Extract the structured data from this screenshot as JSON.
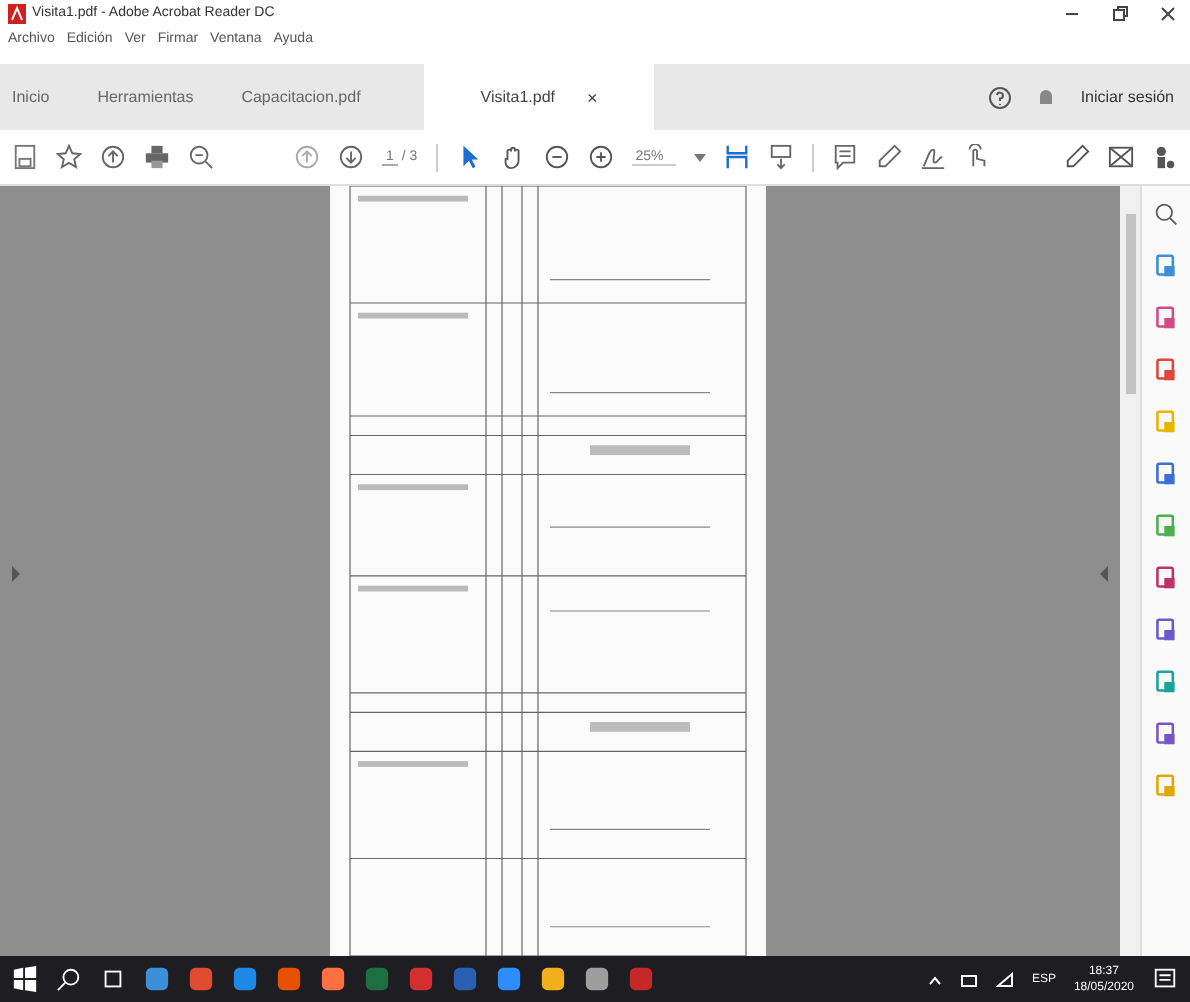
{
  "window": {
    "title": "Visita1.pdf - Adobe Acrobat Reader DC"
  },
  "menu": [
    "Archivo",
    "Edición",
    "Ver",
    "Firmar",
    "Ventana",
    "Ayuda"
  ],
  "tabs": [
    {
      "label": "Inicio",
      "selected": false,
      "closable": false
    },
    {
      "label": "Herramientas",
      "selected": false,
      "closable": false
    },
    {
      "label": "Capacitacion.pdf",
      "selected": false,
      "closable": false
    },
    {
      "label": "Visita1.pdf",
      "selected": true,
      "closable": true
    }
  ],
  "tab_close": "×",
  "sign_in": "Iniciar sesión",
  "toolbar": {
    "page_current": "1",
    "page_total": "/ 3",
    "zoom": "25%"
  },
  "taskbar": {
    "language": "ESP",
    "time": "18:37",
    "date": "18/05/2020"
  }
}
